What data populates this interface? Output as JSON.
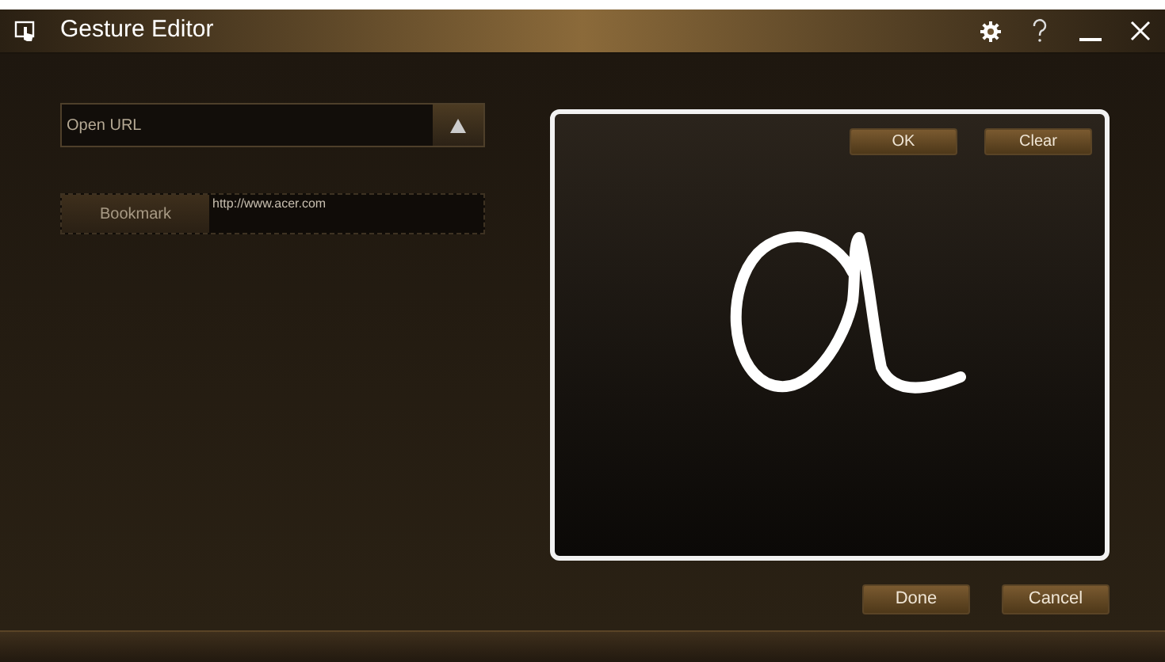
{
  "window": {
    "title": "Gesture Editor"
  },
  "action": {
    "value": "Open URL"
  },
  "bookmark": {
    "label": "Bookmark",
    "value": "http://www.acer.com"
  },
  "canvas": {
    "buttons": [
      "OK",
      "Clear"
    ]
  },
  "footer": {
    "buttons": [
      "Done",
      "Cancel"
    ]
  }
}
